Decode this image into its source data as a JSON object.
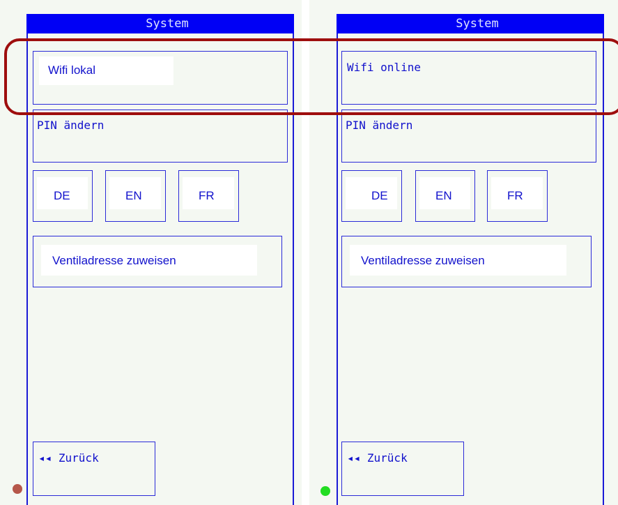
{
  "left": {
    "title": "System",
    "wifi_label": "Wifi lokal",
    "pin_label": "PIN ändern",
    "lang": [
      "DE",
      "EN",
      "FR"
    ],
    "ventil_label": "Ventiladresse zuweisen",
    "back_label": "◂◂ Zurück",
    "status_color": "#b5574a"
  },
  "right": {
    "title": "System",
    "wifi_label": "Wifi online",
    "pin_label": "PIN ändern",
    "lang": [
      "DE",
      "EN",
      "FR"
    ],
    "ventil_label": "Ventiladresse zuweisen",
    "back_label": "◂◂ Zurück",
    "status_color": "#22dd22"
  },
  "colors": {
    "title_bar": "#0000f5",
    "border": "#2a2ad8",
    "highlight": "#9e0e0e",
    "panel_bg": "#f4f8f2"
  }
}
